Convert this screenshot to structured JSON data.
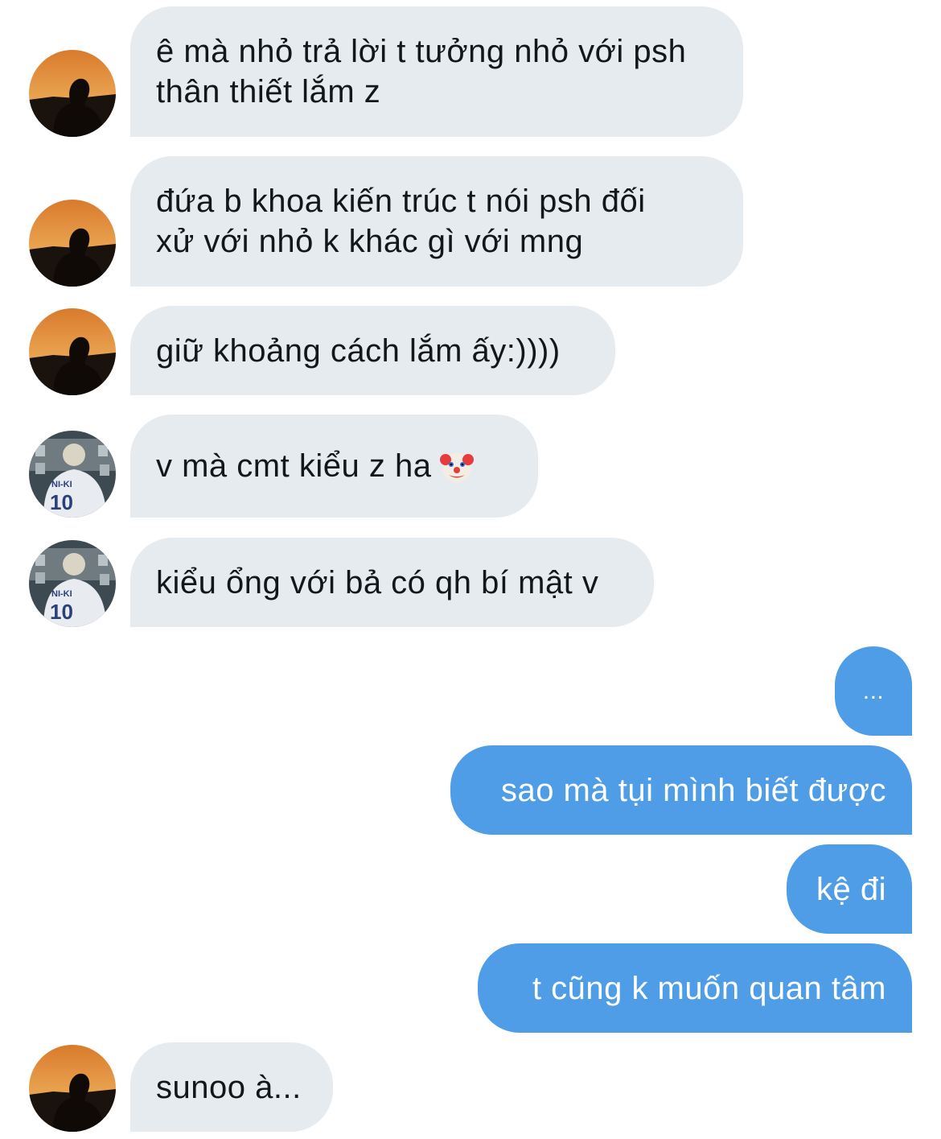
{
  "messages": [
    {
      "side": "in",
      "avatar": "sunset-avatar",
      "lines": [
        "ê mà nhỏ trả lời t tưởng nhỏ với psh",
        "thân thiết lắm z"
      ]
    },
    {
      "side": "in",
      "avatar": "sunset-avatar",
      "lines": [
        "đứa b khoa kiến trúc t nói psh đối",
        "xử với nhỏ k khác gì với mng"
      ]
    },
    {
      "side": "in",
      "avatar": "sunset-avatar",
      "lines": [
        "giữ khoảng cách lắm ấy:))))"
      ]
    },
    {
      "side": "in",
      "avatar": "jersey-avatar",
      "lines": [
        "v mà cmt kiểu z ha"
      ],
      "emoji": "clown-face-icon"
    },
    {
      "side": "in",
      "avatar": "jersey-avatar",
      "lines": [
        "kiểu ổng với bả có qh bí mật v"
      ]
    },
    {
      "side": "out",
      "lines": [
        "..."
      ]
    },
    {
      "side": "out",
      "lines": [
        "sao mà tụi mình biết được"
      ]
    },
    {
      "side": "out",
      "lines": [
        "kệ đi"
      ]
    },
    {
      "side": "out",
      "lines": [
        "t cũng k muốn quan tâm"
      ]
    },
    {
      "side": "in",
      "avatar": "sunset-avatar",
      "lines": [
        "sunoo à..."
      ]
    }
  ],
  "avatars": {
    "sunset": {
      "text": ""
    },
    "jersey": {
      "name": "NI-KI",
      "number": "10"
    }
  },
  "colors": {
    "incoming_bubble": "#e6ebef",
    "outgoing_bubble": "#4e9de6",
    "incoming_text": "#14171a",
    "outgoing_text": "#ffffff"
  }
}
